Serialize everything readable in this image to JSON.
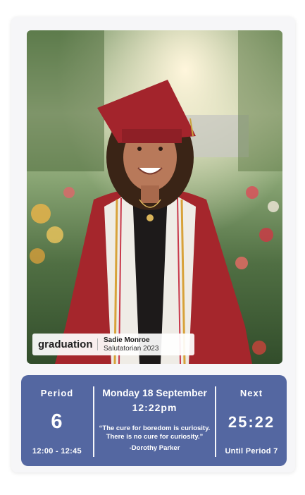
{
  "photo": {
    "alt": "graduation portrait"
  },
  "caption": {
    "tag": "graduation",
    "name": "Sadie Monroe",
    "role": "Salutatorian 2023"
  },
  "period": {
    "label": "Period",
    "number": "6",
    "range": "12:00 - 12:45"
  },
  "center": {
    "date": "Monday 18 September",
    "time": "12:22pm",
    "quote_line1": "“The cure for boredom is curiosity.",
    "quote_line2": "There is no cure for curiosity.”",
    "author": "-Dorothy Parker"
  },
  "next": {
    "label": "Next",
    "countdown": "25:22",
    "until": "Until Period 7"
  },
  "colors": {
    "panel": "#5467a1",
    "gown": "#a5262c"
  }
}
